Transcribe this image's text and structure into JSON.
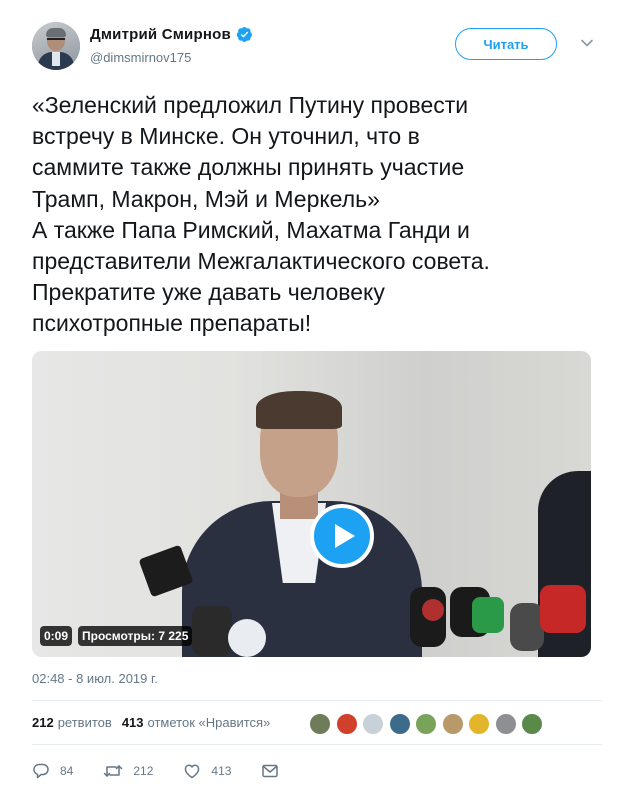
{
  "author": {
    "display_name": "Дмитрий Смирнов",
    "handle": "@dimsmirnov175",
    "verified": true
  },
  "follow_button": {
    "label": "Читать"
  },
  "tweet": {
    "text": "«Зеленский предложил Путину провести\nвстречу в Минске. Он уточнил, что в\nсаммите также должны принять участие\nТрамп, Макрон, Мэй и Меркель»\nА также Папа Римский, Махатма Ганди и\nпредставители Межгалактического совета.\nПрекратите уже давать человеку\nпсихотропные препараты!",
    "timestamp": "02:48 - 8 июл. 2019 г."
  },
  "video": {
    "duration": "0:09",
    "views": "Просмотры: 7 225"
  },
  "stats": {
    "retweets_count": "212",
    "retweets_label": "ретвитов",
    "likes_count": "413",
    "likes_label": "отметок «Нравится»"
  },
  "likers": [
    {
      "icon": "liker-avatar-1",
      "color": "#6f7c5a"
    },
    {
      "icon": "liker-avatar-2",
      "color": "#d0402a"
    },
    {
      "icon": "liker-avatar-3",
      "color": "#c9d1d8"
    },
    {
      "icon": "liker-avatar-4",
      "color": "#3d6b8c"
    },
    {
      "icon": "liker-avatar-5",
      "color": "#7aa35a"
    },
    {
      "icon": "liker-avatar-6",
      "color": "#b89a6a"
    },
    {
      "icon": "liker-avatar-7",
      "color": "#e3b52b"
    },
    {
      "icon": "liker-avatar-8",
      "color": "#8d8f92"
    },
    {
      "icon": "liker-avatar-9",
      "color": "#5a8a4a"
    }
  ],
  "actions": {
    "reply_count": "84",
    "retweet_count": "212",
    "like_count": "413"
  },
  "colors": {
    "accent": "#1da1f2",
    "text": "#14171a",
    "secondary": "#657786"
  }
}
